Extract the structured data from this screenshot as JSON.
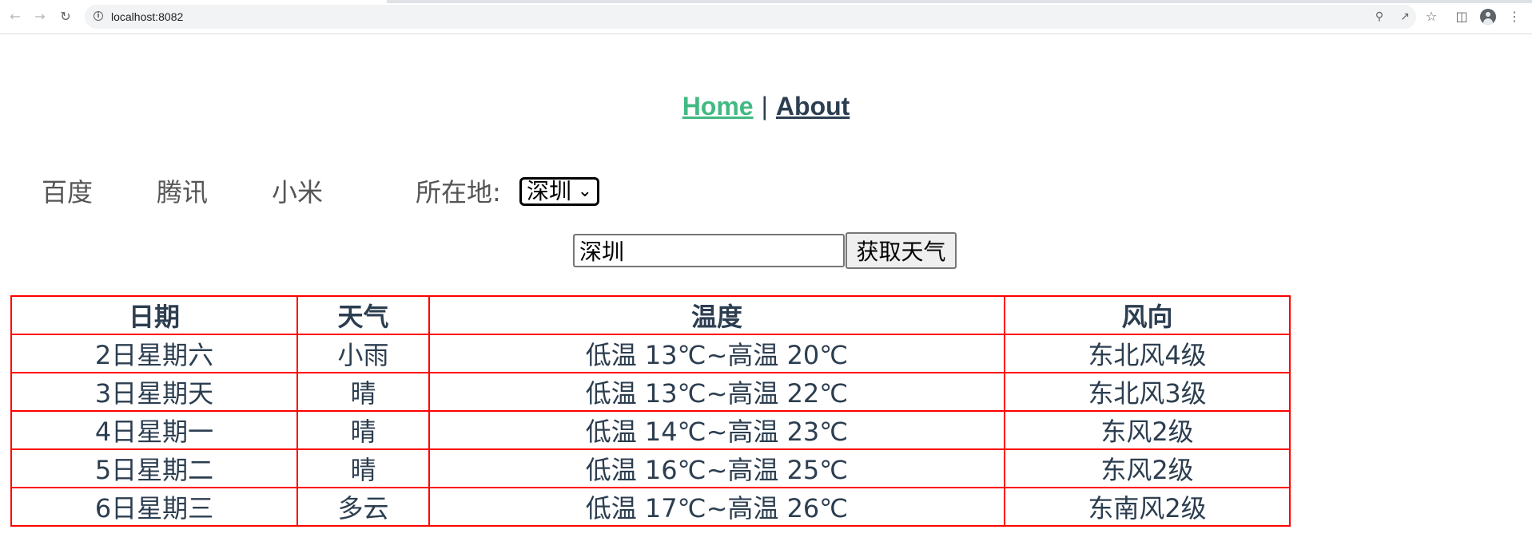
{
  "browser": {
    "url": "localhost:8082",
    "icons": [
      "back-icon",
      "forward-icon",
      "reload-icon",
      "info-icon",
      "zoom-icon",
      "share-icon",
      "star-icon",
      "side-panel-icon",
      "profile-icon",
      "menu-icon"
    ]
  },
  "nav": {
    "home": "Home",
    "separator": "|",
    "about": "About",
    "active_color": "#42b983",
    "text_color": "#2c3e50"
  },
  "menu": {
    "items": [
      "百度",
      "腾讯",
      "小米"
    ],
    "location_label": "所在地:",
    "location_selected": "深圳"
  },
  "search": {
    "input_value": "深圳",
    "button_label": "获取天气"
  },
  "table": {
    "border_color": "#ff0000",
    "headers": [
      "日期",
      "天气",
      "温度",
      "风向"
    ],
    "rows": [
      [
        "2日星期六",
        "小雨",
        "低温 13℃~高温 20℃",
        "东北风4级"
      ],
      [
        "3日星期天",
        "晴",
        "低温 13℃~高温 22℃",
        "东北风3级"
      ],
      [
        "4日星期一",
        "晴",
        "低温 14℃~高温 23℃",
        "东风2级"
      ],
      [
        "5日星期二",
        "晴",
        "低温 16℃~高温 25℃",
        "东风2级"
      ],
      [
        "6日星期三",
        "多云",
        "低温 17℃~高温 26℃",
        "东南风2级"
      ]
    ]
  }
}
